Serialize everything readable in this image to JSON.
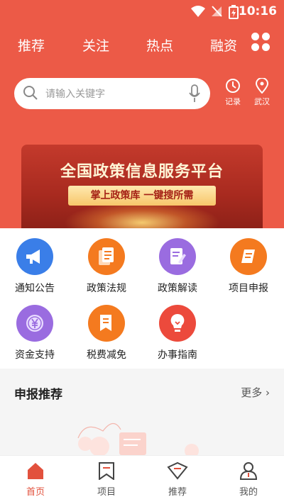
{
  "status_bar": {
    "time": "10:16"
  },
  "nav_tabs": [
    "推荐",
    "关注",
    "热点",
    "融资"
  ],
  "search": {
    "placeholder": "请输入关键字"
  },
  "quick_actions": {
    "history": "记录",
    "location": "武汉"
  },
  "banner": {
    "title": "全国政策信息服务平台",
    "subtitle": "掌上政策库  一键搜所需"
  },
  "services": [
    {
      "label": "通知公告",
      "icon": "megaphone-icon",
      "color": "#3a7ee8"
    },
    {
      "label": "政策法规",
      "icon": "documents-icon",
      "color": "#f47a1f"
    },
    {
      "label": "政策解读",
      "icon": "edit-document-icon",
      "color": "#9a6ce0"
    },
    {
      "label": "项目申报",
      "icon": "scroll-icon",
      "color": "#f47a1f"
    },
    {
      "label": "资金支持",
      "icon": "yuan-coin-icon",
      "color": "#9a6ce0"
    },
    {
      "label": "税费减免",
      "icon": "tax-document-icon",
      "color": "#f47a1f"
    },
    {
      "label": "办事指南",
      "icon": "lightbulb-icon",
      "color": "#ec4a3c"
    }
  ],
  "recommend": {
    "title": "申报推荐",
    "more": "更多"
  },
  "tab_bar": [
    {
      "label": "首页",
      "icon": "home-icon",
      "active": true
    },
    {
      "label": "项目",
      "icon": "bookmark-icon",
      "active": false
    },
    {
      "label": "推荐",
      "icon": "recommend-icon",
      "active": false
    },
    {
      "label": "我的",
      "icon": "person-icon",
      "active": false
    }
  ],
  "colors": {
    "brand": "#ec5a47",
    "active_tab": "#e2513d"
  }
}
